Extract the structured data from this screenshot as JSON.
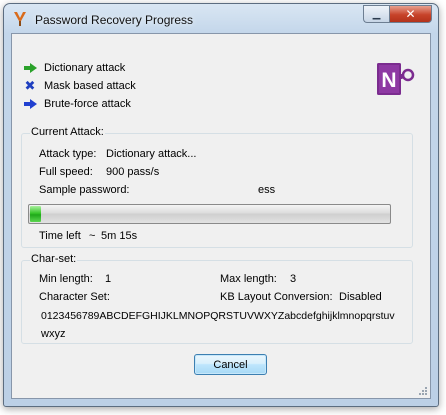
{
  "window": {
    "title": "Password Recovery Progress",
    "close_symbol": "✕",
    "minimize_symbol": "▁"
  },
  "legend": [
    {
      "label": "Dictionary attack",
      "icon": "green-arrow-icon",
      "color": "#2aa12a"
    },
    {
      "label": "Mask based attack",
      "icon": "blue-x-icon",
      "color": "#1f3fc0"
    },
    {
      "label": "Brute-force attack",
      "icon": "blue-arrow-icon",
      "color": "#2040d0"
    }
  ],
  "logo": {
    "letter": "N",
    "color": "#7b2c8f",
    "icon": "onenote-key-icon"
  },
  "current_attack": {
    "title": "Current Attack:",
    "attack_type_label": "Attack type:",
    "attack_type_value": "Dictionary attack...",
    "speed_label": "Full speed:",
    "speed_value": "900 pass/s",
    "sample_label": "Sample password:",
    "sample_value": "ess",
    "progress_fraction": 0.03,
    "time_left_label": "Time left",
    "time_left_approx": "~",
    "time_left_value": "5m 15s"
  },
  "charset": {
    "title": "Char-set:",
    "min_label": "Min length:",
    "min_value": "1",
    "max_label": "Max length:",
    "max_value": "3",
    "charset_label": "Character Set:",
    "kb_label": "KB Layout Conversion:",
    "kb_value": "Disabled",
    "chars_line1": "0123456789ABCDEFGHIJKLMNOPQRSTUVWXYZabcdefghijklmnopqrstuv",
    "chars_line2": "wxyz"
  },
  "buttons": {
    "cancel": "Cancel"
  }
}
